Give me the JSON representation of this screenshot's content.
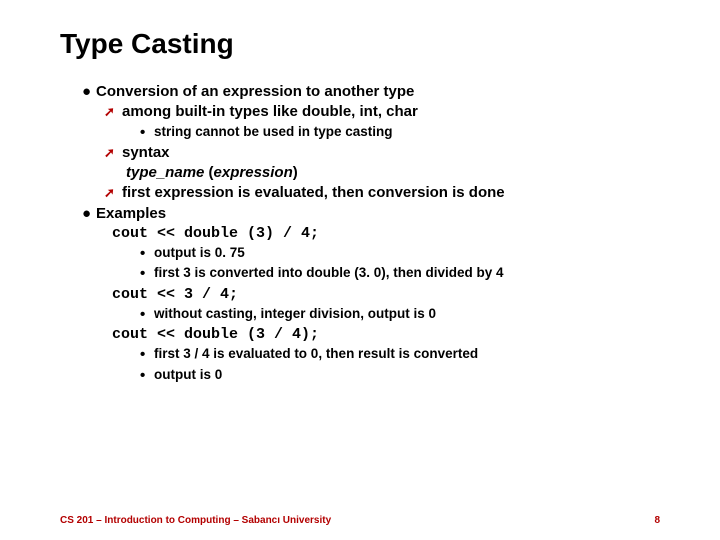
{
  "title": "Type Casting",
  "l1a": "Conversion of an expression to another type",
  "l1a1": "among built-in types like double, int, char",
  "l1a1a": "string cannot be used in type casting",
  "l1a2": "syntax",
  "syntax_type": "type_name ",
  "syntax_par1": "(",
  "syntax_expr": "expression",
  "syntax_par2": ")",
  "l1a3": "first expression is evaluated, then conversion is done",
  "l1b": "Examples",
  "code1": "cout << double (3) / 4;",
  "c1a": "output is 0. 75",
  "c1b": "first 3 is converted into double (3. 0), then divided by 4",
  "code2": "cout << 3 / 4;",
  "c2a": "without casting, integer division, output is 0",
  "code3": "cout << double (3 / 4);",
  "c3a": "first 3 / 4 is evaluated to 0, then result is converted",
  "c3b": "output is 0",
  "footer_left": "CS 201 – Introduction to Computing – Sabancı University",
  "footer_right": "8"
}
